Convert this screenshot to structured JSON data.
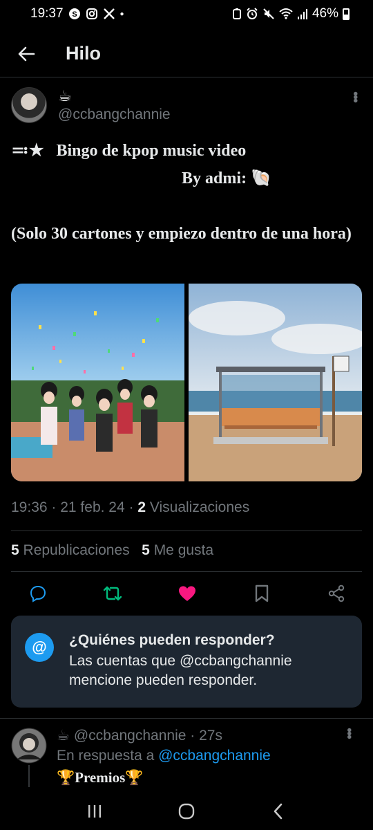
{
  "status_bar": {
    "time": "19:37",
    "battery": "46%",
    "left_icons": [
      "s-icon",
      "instagram-icon",
      "x-icon"
    ],
    "right_icons": [
      "battery-saver-icon",
      "alarm-icon",
      "mute-icon",
      "wifi-icon",
      "signal-icon"
    ]
  },
  "header": {
    "title": "Hilo"
  },
  "post": {
    "author_name": "☕",
    "handle": "@ccbangchannie",
    "line1": "≕★   Bingo de kpop music video",
    "line2": "By admi: 🐚",
    "line3": "(Solo 30 cartones y empiezo dentro de una hora)",
    "media": [
      {
        "alt_icon": "kpop-group-image"
      },
      {
        "alt_icon": "bus-stop-beach-image"
      }
    ],
    "time": "19:36",
    "date": "21 feb. 24",
    "views_count": "2",
    "views_label": "Visualizaciones",
    "reposts_count": "5",
    "reposts_label": "Republicaciones",
    "likes_count": "5",
    "likes_label": "Me gusta"
  },
  "reply_restriction": {
    "title": "¿Quiénes pueden responder?",
    "description": "Las cuentas que @ccbangchannie mencione pueden responder."
  },
  "reply_post": {
    "author_emoji": "☕",
    "handle": "@ccbangchannie",
    "age": "27s",
    "reply_prefix": "En respuesta a",
    "reply_to": "@ccbangchannie",
    "text": "🏆Premios🏆"
  },
  "colors": {
    "background": "#000000",
    "accent": "#1d9bf0",
    "repost_active": "#00ba7c",
    "like_active": "#f91880",
    "muted": "#71767b"
  }
}
